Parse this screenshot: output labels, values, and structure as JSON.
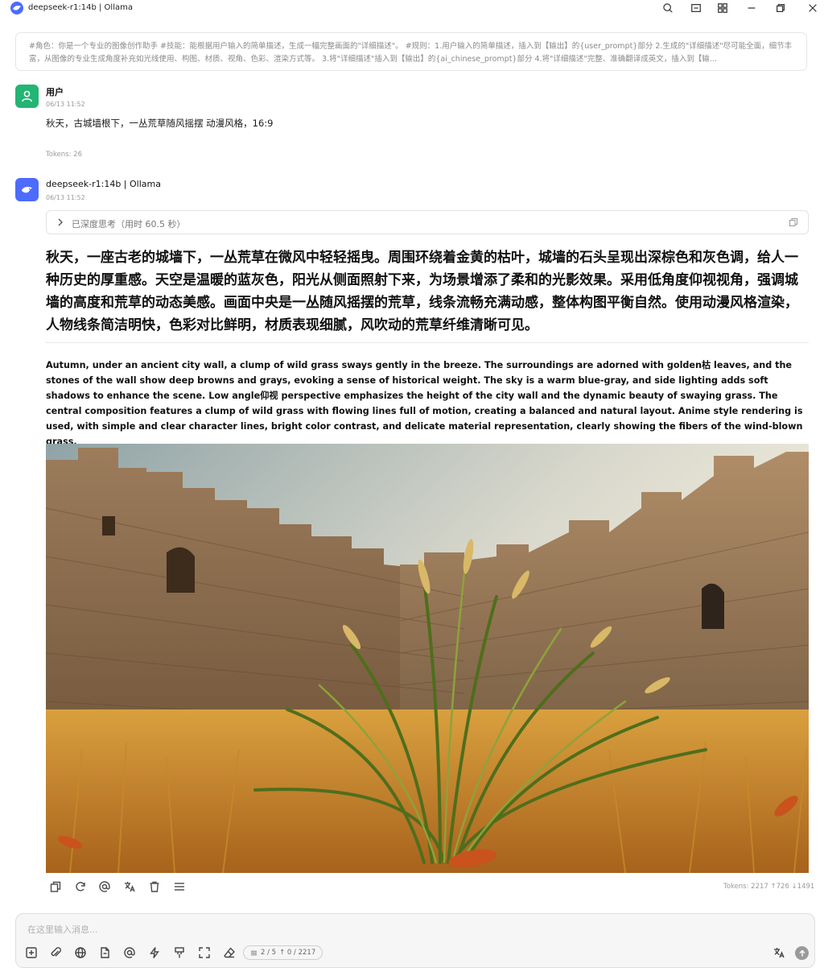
{
  "window": {
    "title": "deepseek-r1:14b | Ollama"
  },
  "system_prompt": {
    "text": "#角色：你是一个专业的图像创作助手 #技能：能根据用户输入的简单描述，生成一幅完整画面的\"详细描述\"。 #规则：1.用户输入的简单描述，插入到【输出】的{user_prompt}部分 2.生成的\"详细描述\"尽可能全面，细节丰富，从图像的专业生成角度补充如光线使用、构图、材质、视角、色彩、渲染方式等。 3.将\"详细描述\"插入到【输出】的{ai_chinese_prompt}部分 4.将\"详细描述\"完整、准确翻译成英文，插入到【输..."
  },
  "user_message": {
    "name": "用户",
    "time": "06/13 11:52",
    "text": "秋天，古城墙根下，一丛荒草随风摇摆 动漫风格，16:9",
    "tokens": "Tokens: 26"
  },
  "assistant_message": {
    "name": "deepseek-r1:14b | Ollama",
    "time": "06/13 11:52",
    "thinking_label": "已深度思考（用时 60.5 秒）",
    "answer_zh": "秋天，一座古老的城墙下，一丛荒草在微风中轻轻摇曳。周围环绕着金黄的枯叶，城墙的石头呈现出深棕色和灰色调，给人一种历史的厚重感。天空是温暖的蓝灰色，阳光从侧面照射下来，为场景增添了柔和的光影效果。采用低角度仰视视角，强调城墙的高度和荒草的动态美感。画面中央是一丛随风摇摆的荒草，线条流畅充满动感，整体构图平衡自然。使用动漫风格渲染，人物线条简洁明快，色彩对比鲜明，材质表现细腻，风吹动的荒草纤维清晰可见。",
    "answer_en": "Autumn, under an ancient city wall, a clump of wild grass sways gently in the breeze. The surroundings are adorned with golden枯 leaves, and the stones of the wall show deep browns and grays, evoking a sense of historical weight. The sky is a warm blue-gray, and side lighting adds soft shadows to enhance the scene. Low angle仰视 perspective emphasizes the height of the city wall and the dynamic beauty of swaying grass. The central composition features a clump of wild grass with flowing lines full of motion, creating a balanced and natural layout. Anime style rendering is used, with simple and clear character lines, bright color contrast, and delicate material representation, clearly showing the fibers of the wind-blown grass.",
    "image_alt": "ancient-city-wall-with-wild-grass",
    "tokens": "Tokens: 2217 ↑726 ↓1491"
  },
  "input": {
    "placeholder": "在这里输入消息...",
    "value": "",
    "context_count": "2 / 5",
    "token_count": "↑ 0 / 2217"
  },
  "colors": {
    "accent": "#4d6bfe",
    "user_avatar": "#22b573",
    "send_button": "#9a9a9a"
  }
}
